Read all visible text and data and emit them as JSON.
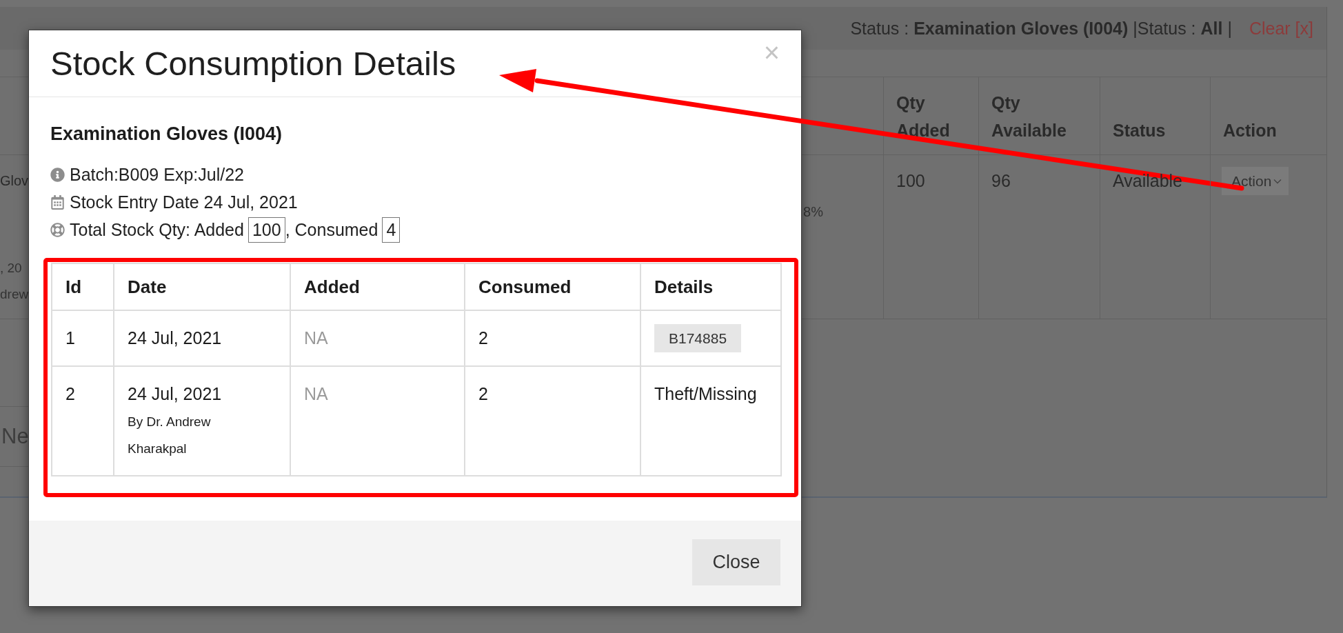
{
  "page": {
    "filter_bar": {
      "summary": "Status : **Examination Gloves (I004)** |Status : **All** |",
      "clear_link": "Clear [x]"
    },
    "table": {
      "columns": [
        "Qty Added",
        "Qty Available",
        "Status",
        "Action"
      ],
      "row": {
        "column_1": [
          "Glov",
          ", 20",
          "drew"
        ],
        "column_2": "8%",
        "qty_added": "100",
        "qty_available": "96",
        "status": "Available",
        "action": "Action"
      }
    },
    "section_heading": "Ne"
  },
  "modal": {
    "title": "Stock Consumption Details",
    "dismiss": "×",
    "item_name": "Examination Gloves (I004)",
    "batch": "Batch:B009 Exp:Jul/22",
    "entry_date": "Stock Entry Date 24 Jul, 2021",
    "total_stock": {
      "label": "Total Stock Qty: Added",
      "added": "100",
      "consumed_label": ", Consumed",
      "consumed": "4"
    },
    "table": {
      "columns": [
        "Id",
        "Date",
        "Added",
        "Consumed",
        "Details"
      ],
      "rows": [
        {
          "id": "1",
          "date": "24 Jul, 2021",
          "added": "NA",
          "consumed": "2",
          "details": {
            "kind": "badge",
            "text": "B174885"
          }
        },
        {
          "id": "2",
          "date": "24 Jul, 2021",
          "author": "By Dr. Andrew Kharakpal",
          "added": "NA",
          "consumed": "2",
          "details": {
            "kind": "text",
            "text": "Theft/Missing"
          }
        }
      ]
    },
    "close_button": "Close"
  }
}
